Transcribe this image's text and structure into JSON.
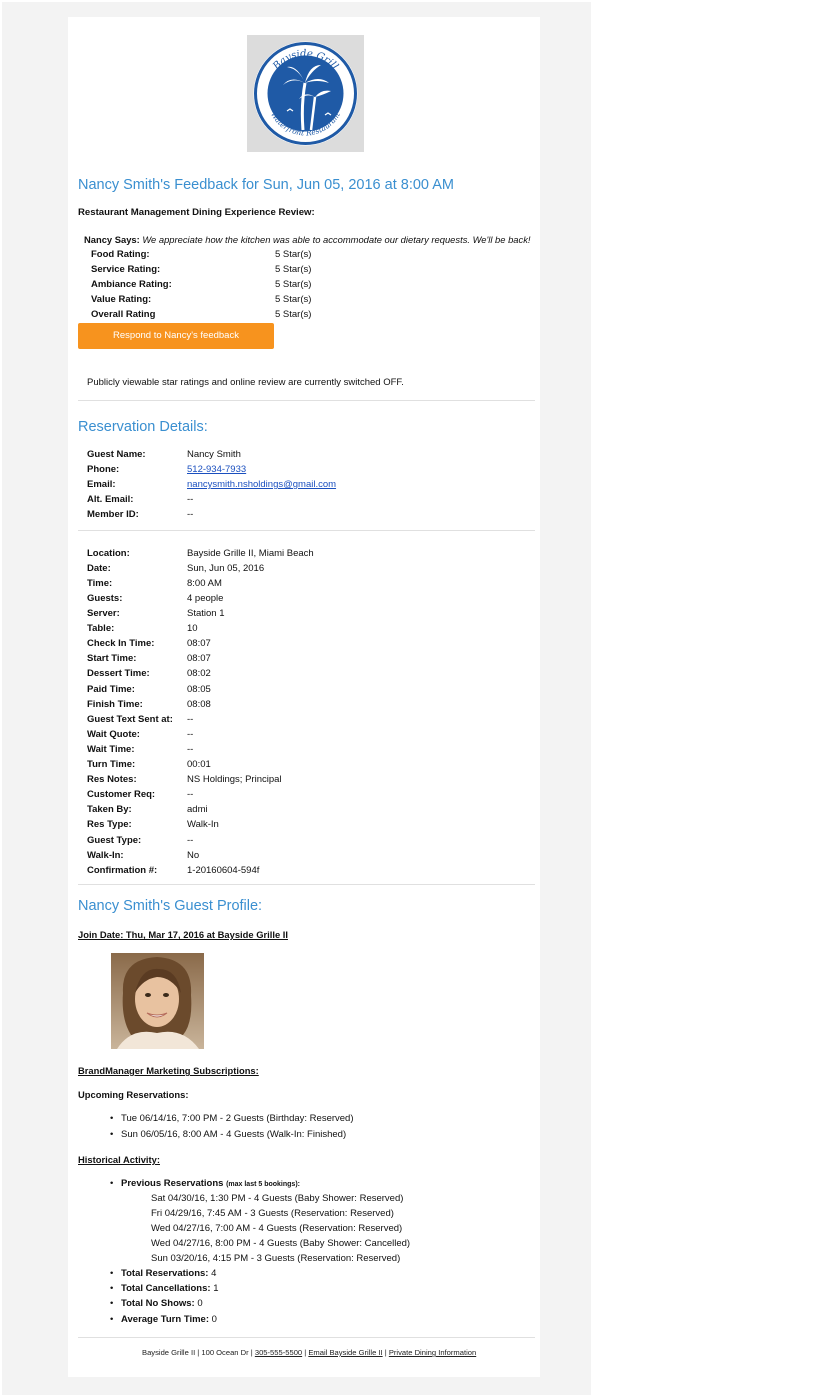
{
  "logo": {
    "top_text": "Bayside Grill",
    "bottom_text": "Waterfront Restaurant"
  },
  "feedback": {
    "title": "Nancy Smith's Feedback for Sun, Jun 05, 2016 at 8:00 AM",
    "subtitle": "Restaurant Management Dining Experience Review:",
    "says_label": "Nancy Says:",
    "says_text": "We appreciate how the kitchen was able to accommodate our dietary requests. We'll be back!",
    "ratings": [
      {
        "label": "Food Rating:",
        "value": "5 Star(s)"
      },
      {
        "label": "Service Rating:",
        "value": "5 Star(s)"
      },
      {
        "label": "Ambiance Rating:",
        "value": "5 Star(s)"
      },
      {
        "label": "Value Rating:",
        "value": "5 Star(s)"
      },
      {
        "label": "Overall Rating",
        "value": "5 Star(s)"
      }
    ],
    "respond_button": "Respond to Nancy's feedback",
    "public_note": "Publicly viewable star ratings and online review are currently switched OFF."
  },
  "reservation": {
    "title": "Reservation Details:",
    "guest": [
      {
        "label": "Guest Name:",
        "value": "Nancy Smith"
      },
      {
        "label": "Phone:",
        "value": "512-934-7933"
      },
      {
        "label": "Email:",
        "value": "nancysmith.nsholdings@gmail.com"
      },
      {
        "label": "Alt. Email:",
        "value": "--"
      },
      {
        "label": "Member ID:",
        "value": "--"
      }
    ],
    "details": [
      {
        "label": "Location:",
        "value": "Bayside Grille II, Miami Beach"
      },
      {
        "label": "Date:",
        "value": "Sun, Jun 05, 2016"
      },
      {
        "label": "Time:",
        "value": "8:00 AM"
      },
      {
        "label": "Guests:",
        "value": "4 people"
      },
      {
        "label": "Server:",
        "value": "Station 1"
      },
      {
        "label": "Table:",
        "value": "10"
      },
      {
        "label": "Check In Time:",
        "value": "08:07"
      },
      {
        "label": "Start Time:",
        "value": "08:07"
      },
      {
        "label": "Dessert Time:",
        "value": "08:02"
      },
      {
        "label": "Paid Time:",
        "value": "08:05"
      },
      {
        "label": "Finish Time:",
        "value": "08:08"
      },
      {
        "label": "Guest Text Sent at:",
        "value": "--"
      },
      {
        "label": "Wait Quote:",
        "value": "--"
      },
      {
        "label": "Wait Time:",
        "value": "--"
      },
      {
        "label": "Turn Time:",
        "value": "00:01"
      },
      {
        "label": "Res Notes:",
        "value": "NS Holdings; Principal"
      },
      {
        "label": "Customer Req:",
        "value": "--"
      },
      {
        "label": "Taken By:",
        "value": "admi"
      },
      {
        "label": "Res Type:",
        "value": "Walk-In"
      },
      {
        "label": "Guest Type:",
        "value": "--"
      },
      {
        "label": "Walk-In:",
        "value": "No"
      },
      {
        "label": "Confirmation #:",
        "value": "1-20160604-594f"
      }
    ]
  },
  "profile": {
    "title": "Nancy Smith's Guest Profile:",
    "join_date": "Join Date: Thu, Mar 17, 2016 at Bayside Grille II",
    "subscriptions_heading": "BrandManager Marketing Subscriptions:",
    "upcoming_heading": "Upcoming Reservations:",
    "upcoming": [
      "Tue 06/14/16, 7:00 PM - 2 Guests (Birthday: Reserved)",
      "Sun 06/05/16, 8:00 AM - 4 Guests (Walk-In: Finished)"
    ],
    "historical_heading": "Historical Activity:",
    "previous_label": "Previous Reservations",
    "previous_note": "(max last 5 bookings):",
    "previous": [
      "Sat 04/30/16, 1:30 PM - 4 Guests (Baby Shower: Reserved)",
      "Fri 04/29/16, 7:45 AM - 3 Guests (Reservation: Reserved)",
      "Wed 04/27/16, 7:00 AM - 4 Guests (Reservation: Reserved)",
      "Wed 04/27/16, 8:00 PM - 4 Guests (Baby Shower: Cancelled)",
      "Sun 03/20/16, 4:15 PM - 3 Guests (Reservation: Reserved)"
    ],
    "totals": [
      {
        "label": "Total Reservations:",
        "value": "4"
      },
      {
        "label": "Total Cancellations:",
        "value": "1"
      },
      {
        "label": "Total No Shows:",
        "value": "0"
      },
      {
        "label": "Average Turn Time:",
        "value": "0"
      }
    ]
  },
  "footer": {
    "prefix": "Bayside Grille II | 100 Ocean Dr | ",
    "phone": "305-555-5500",
    "sep1": " | ",
    "email_link": "Email Bayside Grille II",
    "sep2": " | ",
    "private_link": "Private Dining Information"
  },
  "colors": {
    "accent": "#3a8fd0",
    "button": "#f7931e",
    "logo_blue": "#1f5aa6"
  }
}
